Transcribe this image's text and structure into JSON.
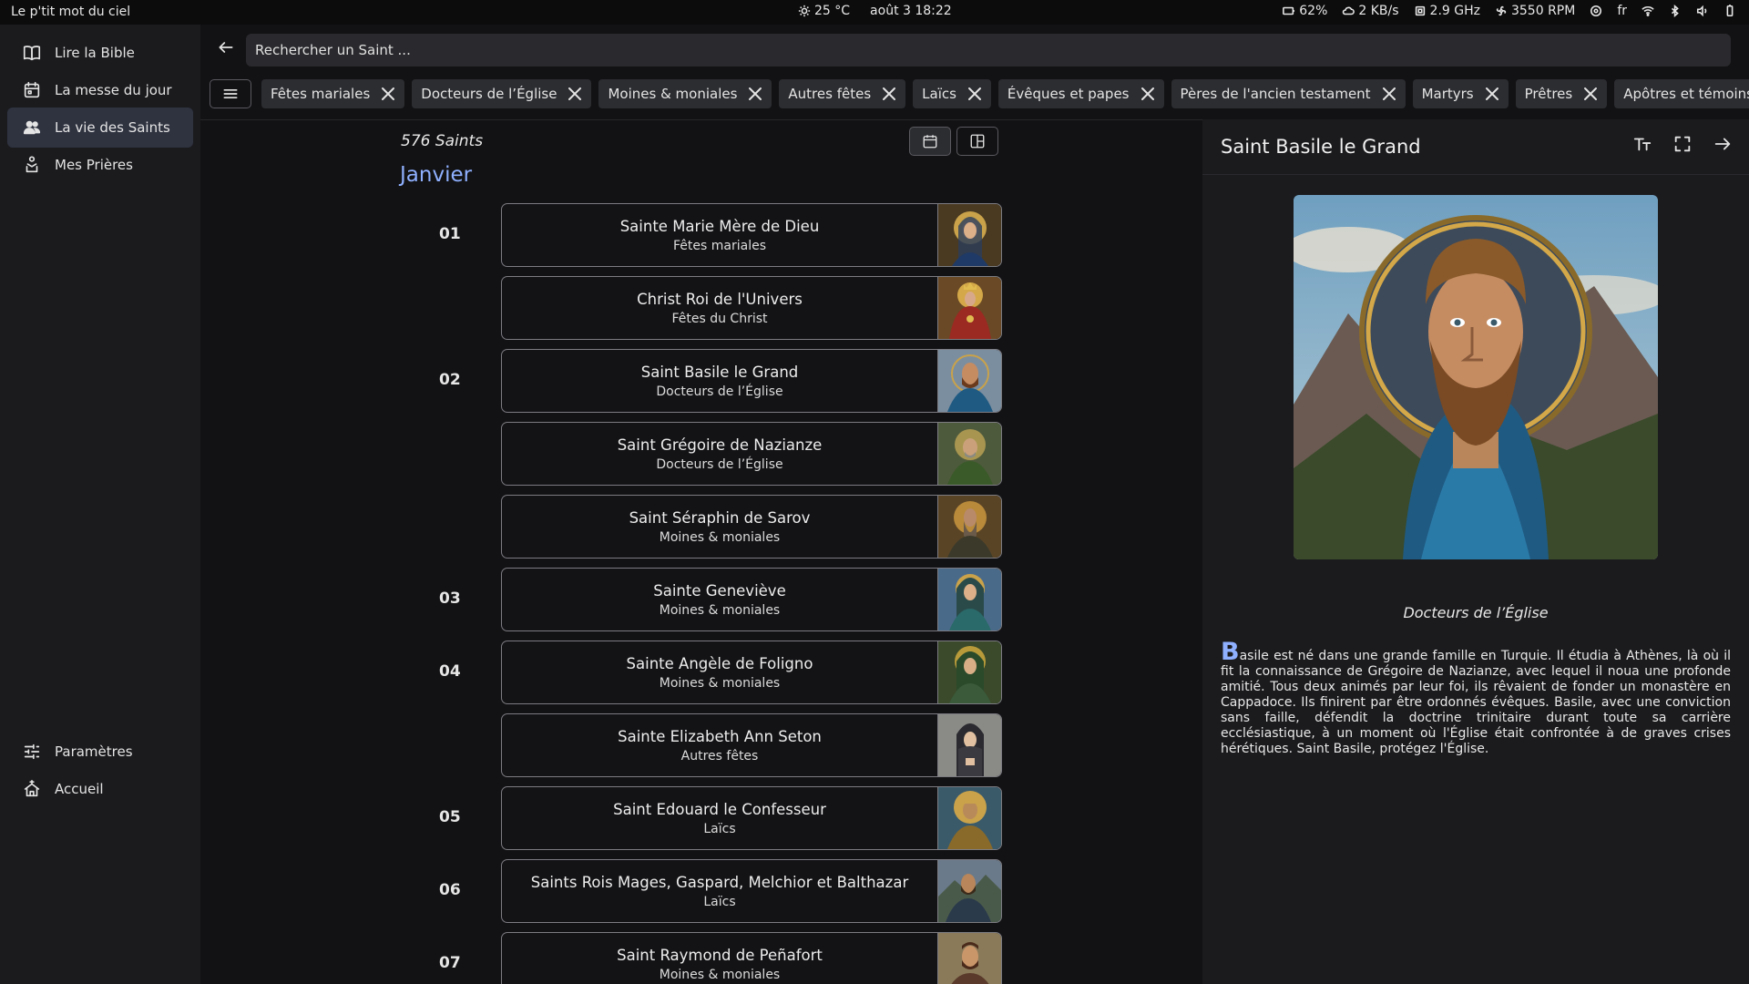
{
  "system_bar": {
    "app_title": "Le p'tit mot du ciel",
    "weather": "25 °C",
    "datetime": "août 3  18:22",
    "battery": "62%",
    "network": "2 KB/s",
    "cpu": "2.9 GHz",
    "fan": "3550 RPM",
    "lang": "fr"
  },
  "sidebar": {
    "items": [
      {
        "label": "Lire la Bible",
        "icon": "book-icon"
      },
      {
        "label": "La messe du jour",
        "icon": "calendar-icon"
      },
      {
        "label": "La vie des Saints",
        "icon": "people-icon",
        "active": true
      },
      {
        "label": "Mes Prières",
        "icon": "prayer-icon"
      }
    ],
    "bottom_items": [
      {
        "label": "Paramètres",
        "icon": "settings-icon"
      },
      {
        "label": "Accueil",
        "icon": "home-icon"
      }
    ]
  },
  "search": {
    "placeholder": "Rechercher un Saint ..."
  },
  "filters": [
    "Fêtes mariales",
    "Docteurs de l’Église",
    "Moines & moniales",
    "Autres fêtes",
    "Laïcs",
    "Évêques et papes",
    "Pères de l'ancien testament",
    "Martyrs",
    "Prêtres",
    "Apôtres et témoins du Ch"
  ],
  "list": {
    "count": "576 Saints",
    "month": "Janvier",
    "days": [
      "01",
      "02",
      "03",
      "04",
      "05",
      "06",
      "07"
    ],
    "saints": [
      {
        "name": "Sainte Marie Mère de Dieu",
        "category": "Fêtes mariales"
      },
      {
        "name": "Christ Roi de l'Univers",
        "category": "Fêtes du Christ"
      },
      {
        "name": "Saint Basile le Grand",
        "category": "Docteurs de l’Église"
      },
      {
        "name": "Saint Grégoire de Nazianze",
        "category": "Docteurs de l’Église"
      },
      {
        "name": "Saint Séraphin de Sarov",
        "category": "Moines & moniales"
      },
      {
        "name": "Sainte Geneviève",
        "category": "Moines & moniales"
      },
      {
        "name": "Sainte Angèle de Foligno",
        "category": "Moines & moniales"
      },
      {
        "name": "Sainte Elizabeth Ann Seton",
        "category": "Autres fêtes"
      },
      {
        "name": "Saint Edouard le Confesseur",
        "category": "Laïcs"
      },
      {
        "name": "Saints Rois Mages, Gaspard, Melchior et Balthazar",
        "category": "Laïcs"
      },
      {
        "name": "Saint Raymond de Peñafort",
        "category": "Moines & moniales"
      }
    ]
  },
  "detail": {
    "title": "Saint Basile le Grand",
    "category": "Docteurs de l’Église",
    "bio_initial": "B",
    "bio_rest": "asile est né dans une grande famille en Turquie. Il étudia à Athènes, là où il fit la connaissance de Grégoire de Nazianze, avec lequel il noua une profonde amitié. Tous deux animés par leur foi, ils rêvaient de fonder un monastère en Cappadoce. Ils finirent par être ordonnés évêques. Basile, avec une conviction sans faille, défendit la doctrine trinitaire durant toute sa carrière ecclésiastique, à un moment où l'Église était confrontée à de graves crises hérétiques. Saint Basile, protégez l'Église."
  },
  "colors": {
    "accent": "#8fb0ff",
    "active_nav": "#2f3340"
  }
}
